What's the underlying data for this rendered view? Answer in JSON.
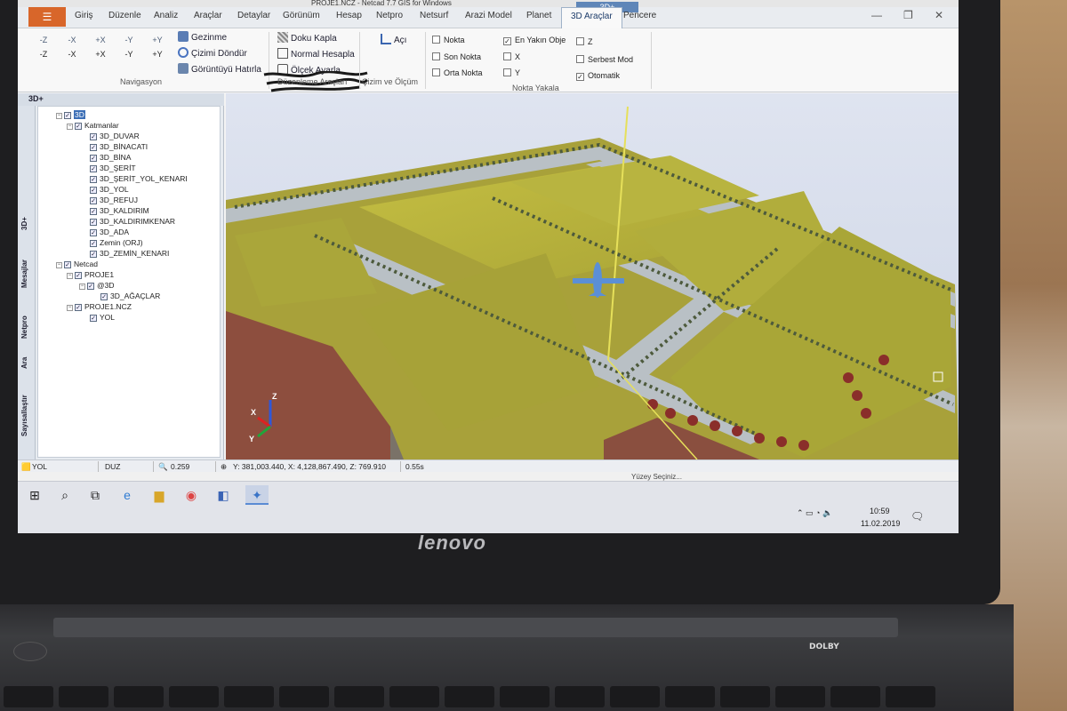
{
  "window": {
    "title": "PROJE1.NCZ - Netcad 7.7 GIS for Windows",
    "context_tab_group": "3D+",
    "controls": [
      "—",
      "❐",
      "✕"
    ]
  },
  "tabs": [
    {
      "label": "Giriş"
    },
    {
      "label": "Düzenle"
    },
    {
      "label": "Analiz"
    },
    {
      "label": "Araçlar"
    },
    {
      "label": "Detaylar"
    },
    {
      "label": "Görünüm"
    },
    {
      "label": "Hesap"
    },
    {
      "label": "Netpro"
    },
    {
      "label": "Netsurf"
    },
    {
      "label": "Arazi Model"
    },
    {
      "label": "Planet"
    },
    {
      "label": "3D Araçlar"
    },
    {
      "label": "Pencere"
    }
  ],
  "ribbon": {
    "navigation": {
      "axis_top": [
        "-Z",
        "-X",
        "+X",
        "-Y",
        "+Y"
      ],
      "axis_bottom": [
        "-Z",
        "-X",
        "+X",
        "-Y",
        "+Y"
      ],
      "gezinme": "Gezinme",
      "cizimi_dondur": "Çizimi Döndür",
      "goruntuyu_hatirla": "Görüntüyü Hatırla",
      "group_label": "Navigasyon"
    },
    "edit_tools": {
      "doku_kapla": "Doku Kapla",
      "normal_hesapla": "Normal Hesapla",
      "olcek_ayarla": "Ölçek Ayarla",
      "group_label": "Düzenleme Araçları"
    },
    "draw_measure": {
      "aci": "Açı",
      "group_label": "Çizim ve Ölçüm"
    },
    "snap": {
      "group_label": "Nokta Yakala",
      "options": [
        {
          "label": "Nokta",
          "checked": false
        },
        {
          "label": "Son Nokta",
          "checked": false
        },
        {
          "label": "Orta Nokta",
          "checked": false
        },
        {
          "label": "En Yakın Obje",
          "checked": true
        },
        {
          "label": "X",
          "checked": false
        },
        {
          "label": "Y",
          "checked": false
        },
        {
          "label": "Z",
          "checked": false
        },
        {
          "label": "Serbest Mod",
          "checked": false
        },
        {
          "label": "Otomatik",
          "checked": true
        }
      ]
    }
  },
  "panel": {
    "title": "3D+",
    "side_tabs": [
      "3D+",
      "Mesajlar",
      "Netpro",
      "Ara",
      "Sayısallaştır"
    ],
    "tree": [
      {
        "label": "3D",
        "checked": true,
        "selected": true,
        "expander": "−"
      },
      {
        "label": "Katmanlar",
        "checked": true,
        "expander": "−"
      },
      {
        "label": "3D_DUVAR",
        "checked": true
      },
      {
        "label": "3D_BİNACATI",
        "checked": true
      },
      {
        "label": "3D_BİNA",
        "checked": true
      },
      {
        "label": "3D_ŞERİT",
        "checked": true
      },
      {
        "label": "3D_ŞERİT_YOL_KENARI",
        "checked": true
      },
      {
        "label": "3D_YOL",
        "checked": true
      },
      {
        "label": "3D_REFUJ",
        "checked": true
      },
      {
        "label": "3D_KALDIRIM",
        "checked": true
      },
      {
        "label": "3D_KALDIRIMKENAR",
        "checked": true
      },
      {
        "label": "3D_ADA",
        "checked": true
      },
      {
        "label": "Zemin (ORJ)",
        "checked": true
      },
      {
        "label": "3D_ZEMİN_KENARI",
        "checked": true
      },
      {
        "label": "Netcad",
        "checked": true,
        "expander": "−"
      },
      {
        "label": "PROJE1",
        "checked": true,
        "expander": "−"
      },
      {
        "label": "@3D",
        "checked": true,
        "expander": "−"
      },
      {
        "label": "3D_AĞAÇLAR",
        "checked": true
      },
      {
        "label": "PROJE1.NCZ",
        "checked": true,
        "expander": "−"
      },
      {
        "label": "YOL",
        "checked": true
      }
    ]
  },
  "status": {
    "layer": "YOL",
    "mode": "DUZ",
    "scale": "0.259",
    "coords": "Y: 381,003.440, X: 4,128,867.490, Z: 769.910",
    "time": "0.55s",
    "prompt": "Yüzey Seçiniz..."
  },
  "taskbar": {
    "time": "10:59",
    "date": "11.02.2019",
    "icons": [
      "windows-icon",
      "search-icon",
      "task-view-icon",
      "edge-icon",
      "file-explorer-icon",
      "chrome-icon",
      "app-icon",
      "netcad-icon"
    ]
  },
  "laptop": {
    "brand": "lenovo",
    "audio_badge": "DOLBY"
  },
  "colors": {
    "accent": "#d8662a",
    "selection": "#3c6fb6",
    "terrain": "#b8b43a",
    "road": "#b9c0c5"
  }
}
